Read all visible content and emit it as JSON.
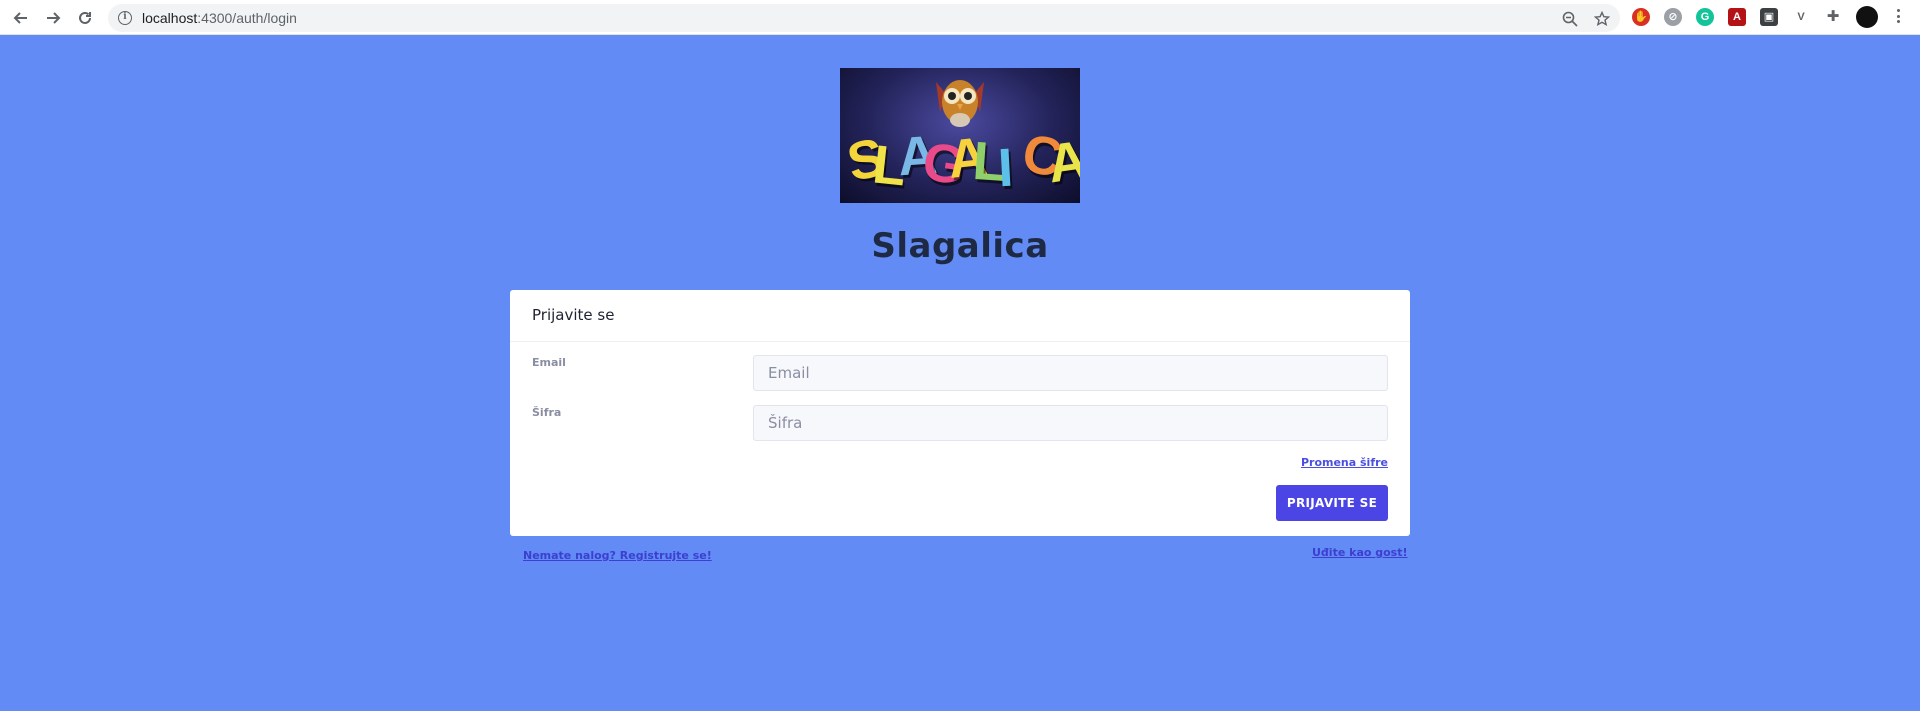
{
  "browser": {
    "url_host": "localhost",
    "url_path": ":4300/auth/login",
    "back_icon": "arrow-left-icon",
    "forward_icon": "arrow-right-icon",
    "reload_icon": "reload-icon",
    "info_icon": "info-icon",
    "zoom_icon": "zoom-out-icon",
    "star_icon": "star-icon",
    "extensions_icon": "puzzle-icon",
    "menu_icon": "kebab-menu-icon"
  },
  "logo": {
    "letters": [
      "S",
      "L",
      "A",
      "G",
      "A",
      "L",
      "I",
      "C",
      "A"
    ],
    "letter_colors": [
      "#f3d43a",
      "#f0e34a",
      "#7ab8e8",
      "#e84a8a",
      "#f7d23c",
      "#8fd06a",
      "#5cc0e8",
      "#f08a3a",
      "#e8e44a"
    ]
  },
  "page": {
    "title": "Slagalica"
  },
  "login": {
    "heading": "Prijavite se",
    "email_label": "Email",
    "email_placeholder": "Email",
    "email_value": "",
    "password_label": "Šifra",
    "password_placeholder": "Šifra",
    "password_value": "",
    "forgot_link": "Promena šifre",
    "submit_label": "PRIJAVITE SE"
  },
  "footer": {
    "register_link": "Nemate nalog? Registrujte se!",
    "guest_link": "Uđite kao gost!"
  },
  "colors": {
    "background": "#628bf6",
    "primary_button": "#4b45e6",
    "title": "#1e2a44"
  }
}
